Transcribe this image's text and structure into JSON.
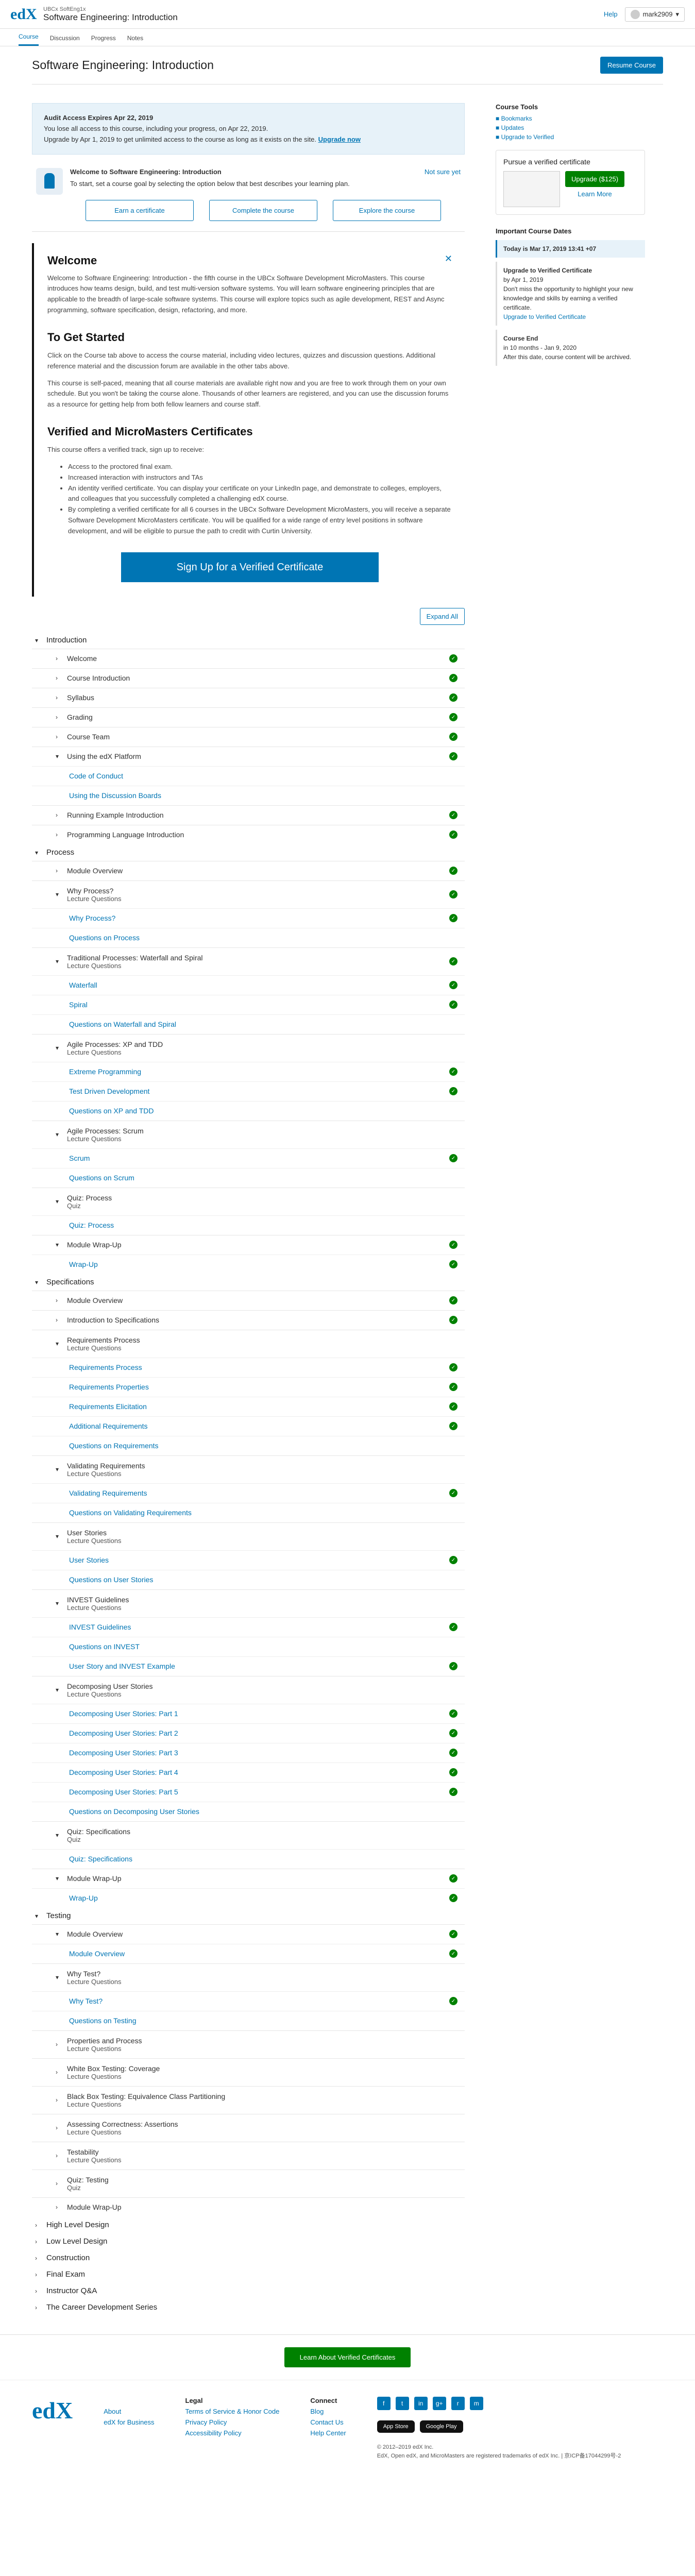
{
  "header": {
    "logo": "edX",
    "org": "UBCx SoftEng1x",
    "course_title": "Software Engineering: Introduction",
    "help": "Help",
    "user": "mark2909"
  },
  "tabs": [
    "Course",
    "Discussion",
    "Progress",
    "Notes"
  ],
  "page": {
    "title": "Software Engineering: Introduction",
    "resume": "Resume Course"
  },
  "alert": {
    "title": "Audit Access Expires Apr 22, 2019",
    "line1": "You lose all access to this course, including your progress, on Apr 22, 2019.",
    "line2": "Upgrade by Apr 1, 2019 to get unlimited access to the course as long as it exists on the site.",
    "link": "Upgrade now"
  },
  "goal": {
    "title": "Welcome to Software Engineering: Introduction",
    "not_sure": "Not sure yet",
    "text": "To start, set a course goal by selecting the option below that best describes your learning plan.",
    "buttons": [
      "Earn a certificate",
      "Complete the course",
      "Explore the course"
    ]
  },
  "welcome": {
    "h_welcome": "Welcome",
    "p1": "Welcome to Software Engineering: Introduction - the fifth course in the UBCx Software Development MicroMasters. This course introduces how teams design, build, and test multi-version software systems. You will learn software engineering principles that are applicable to the breadth of large-scale software systems. This course will explore topics such as agile development, REST and Async programming, software specification, design, refactoring, and more.",
    "h_started": "To Get Started",
    "p2": "Click on the Course tab above to access the course material, including video lectures, quizzes and discussion questions. Additional reference material and the discussion forum are available in the other tabs above.",
    "p3": "This course is self-paced, meaning that all course materials are available right now and you are free to work through them on your own schedule. But you won't be taking the course alone. Thousands of other learners are registered, and you can use the discussion forums as a resource for getting help from both fellow learners and course staff.",
    "h_verified": "Verified and MicroMasters Certificates",
    "p4": "This course offers a verified track, sign up to receive:",
    "bullets": [
      "Access to the proctored final exam.",
      "Increased interaction with instructors and TAs",
      "An identity verified certificate. You can display your certificate on your LinkedIn page, and demonstrate to colleges, employers, and colleagues that you successfully completed a challenging edX course.",
      "By completing a verified certificate for all 6 courses in the UBCx Software Development MicroMasters, you will receive a separate Software Development MicroMasters certificate. You will be qualified for a wide range of entry level positions in software development, and will be eligible to pursue the path to credit with Curtin University."
    ],
    "signup": "Sign Up for a Verified Certificate"
  },
  "expand_all": "Expand All",
  "outline": [
    {
      "title": "Introduction",
      "open": true,
      "subs": [
        {
          "title": "Welcome",
          "done": true
        },
        {
          "title": "Course Introduction",
          "done": true
        },
        {
          "title": "Syllabus",
          "done": true
        },
        {
          "title": "Grading",
          "done": true
        },
        {
          "title": "Course Team",
          "done": true
        },
        {
          "title": "Using the edX Platform",
          "done": true,
          "open": true,
          "units": [
            {
              "title": "Code of Conduct",
              "done": false
            },
            {
              "title": "Using the Discussion Boards",
              "done": false
            }
          ]
        },
        {
          "title": "Running Example Introduction",
          "done": true
        },
        {
          "title": "Programming Language Introduction",
          "done": true
        }
      ]
    },
    {
      "title": "Process",
      "open": true,
      "subs": [
        {
          "title": "Module Overview",
          "done": true
        },
        {
          "title": "Why Process?",
          "type": "Lecture Questions",
          "done": true,
          "open": true,
          "units": [
            {
              "title": "Why Process?",
              "done": true
            },
            {
              "title": "Questions on Process",
              "done": false
            }
          ]
        },
        {
          "title": "Traditional Processes: Waterfall and Spiral",
          "type": "Lecture Questions",
          "done": true,
          "open": true,
          "units": [
            {
              "title": "Waterfall",
              "done": true
            },
            {
              "title": "Spiral",
              "done": true
            },
            {
              "title": "Questions on Waterfall and Spiral",
              "done": false
            }
          ]
        },
        {
          "title": "Agile Processes: XP and TDD",
          "type": "Lecture Questions",
          "done": false,
          "open": true,
          "units": [
            {
              "title": "Extreme Programming",
              "done": true
            },
            {
              "title": "Test Driven Development",
              "done": true
            },
            {
              "title": "Questions on XP and TDD",
              "done": false
            }
          ]
        },
        {
          "title": "Agile Processes: Scrum",
          "type": "Lecture Questions",
          "done": false,
          "open": true,
          "units": [
            {
              "title": "Scrum",
              "done": true
            },
            {
              "title": "Questions on Scrum",
              "done": false
            }
          ]
        },
        {
          "title": "Quiz: Process",
          "type": "Quiz",
          "done": false,
          "open": true,
          "units": [
            {
              "title": "Quiz: Process",
              "done": false
            }
          ]
        },
        {
          "title": "Module Wrap-Up",
          "done": true,
          "open": true,
          "units": [
            {
              "title": "Wrap-Up",
              "done": true
            }
          ]
        }
      ]
    },
    {
      "title": "Specifications",
      "open": true,
      "subs": [
        {
          "title": "Module Overview",
          "done": true
        },
        {
          "title": "Introduction to Specifications",
          "done": true
        },
        {
          "title": "Requirements Process",
          "type": "Lecture Questions",
          "done": false,
          "open": true,
          "units": [
            {
              "title": "Requirements Process",
              "done": true
            },
            {
              "title": "Requirements Properties",
              "done": true
            },
            {
              "title": "Requirements Elicitation",
              "done": true
            },
            {
              "title": "Additional Requirements",
              "done": true
            },
            {
              "title": "Questions on Requirements",
              "done": false
            }
          ]
        },
        {
          "title": "Validating Requirements",
          "type": "Lecture Questions",
          "done": false,
          "open": true,
          "units": [
            {
              "title": "Validating Requirements",
              "done": true
            },
            {
              "title": "Questions on Validating Requirements",
              "done": false
            }
          ]
        },
        {
          "title": "User Stories",
          "type": "Lecture Questions",
          "done": false,
          "open": true,
          "units": [
            {
              "title": "User Stories",
              "done": true
            },
            {
              "title": "Questions on User Stories",
              "done": false
            }
          ]
        },
        {
          "title": "INVEST Guidelines",
          "type": "Lecture Questions",
          "done": false,
          "open": true,
          "units": [
            {
              "title": "INVEST Guidelines",
              "done": true
            },
            {
              "title": "Questions on INVEST",
              "done": false
            },
            {
              "title": "User Story and INVEST Example",
              "done": true
            }
          ]
        },
        {
          "title": "Decomposing User Stories",
          "type": "Lecture Questions",
          "done": false,
          "open": true,
          "units": [
            {
              "title": "Decomposing User Stories: Part 1",
              "done": true
            },
            {
              "title": "Decomposing User Stories: Part 2",
              "done": true
            },
            {
              "title": "Decomposing User Stories: Part 3",
              "done": true
            },
            {
              "title": "Decomposing User Stories: Part 4",
              "done": true
            },
            {
              "title": "Decomposing User Stories: Part 5",
              "done": true
            },
            {
              "title": "Questions on Decomposing User Stories",
              "done": false
            }
          ]
        },
        {
          "title": "Quiz: Specifications",
          "type": "Quiz",
          "done": false,
          "open": true,
          "units": [
            {
              "title": "Quiz: Specifications",
              "done": false
            }
          ]
        },
        {
          "title": "Module Wrap-Up",
          "done": true,
          "open": true,
          "units": [
            {
              "title": "Wrap-Up",
              "done": true
            }
          ]
        }
      ]
    },
    {
      "title": "Testing",
      "open": true,
      "subs": [
        {
          "title": "Module Overview",
          "done": true,
          "open": true,
          "units": [
            {
              "title": "Module Overview",
              "done": true
            }
          ]
        },
        {
          "title": "Why Test?",
          "type": "Lecture Questions",
          "done": false,
          "open": true,
          "units": [
            {
              "title": "Why Test?",
              "done": true
            },
            {
              "title": "Questions on Testing",
              "done": false
            }
          ]
        },
        {
          "title": "Properties and Process",
          "type": "Lecture Questions",
          "done": false
        },
        {
          "title": "White Box Testing: Coverage",
          "type": "Lecture Questions",
          "done": false
        },
        {
          "title": "Black Box Testing: Equivalence Class Partitioning",
          "type": "Lecture Questions",
          "done": false
        },
        {
          "title": "Assessing Correctness: Assertions",
          "type": "Lecture Questions",
          "done": false
        },
        {
          "title": "Testability",
          "type": "Lecture Questions",
          "done": false
        },
        {
          "title": "Quiz: Testing",
          "type": "Quiz",
          "done": false
        },
        {
          "title": "Module Wrap-Up",
          "done": false
        }
      ]
    },
    {
      "title": "High Level Design",
      "open": false,
      "subs": []
    },
    {
      "title": "Low Level Design",
      "open": false,
      "subs": []
    },
    {
      "title": "Construction",
      "open": false,
      "subs": []
    },
    {
      "title": "Final Exam",
      "open": false,
      "subs": []
    },
    {
      "title": "Instructor Q&A",
      "open": false,
      "subs": []
    },
    {
      "title": "The Career Development Series",
      "open": false,
      "subs": []
    }
  ],
  "sidebar": {
    "tools_title": "Course Tools",
    "tools": [
      "Bookmarks",
      "Updates",
      "Upgrade to Verified"
    ],
    "verify_title": "Pursue a verified certificate",
    "upgrade_btn": "Upgrade ($125)",
    "learn_more": "Learn More",
    "dates_title": "Important Course Dates",
    "today": "Today is Mar 17, 2019 13:41 +07",
    "dates": [
      {
        "title": "Upgrade to Verified Certificate",
        "date": "by Apr 1, 2019",
        "text": "Don't miss the opportunity to highlight your new knowledge and skills by earning a verified certificate.",
        "link": "Upgrade to Verified Certificate"
      },
      {
        "title": "Course End",
        "date": "in 10 months - Jan 9, 2020",
        "text": "After this date, course content will be archived.",
        "link": ""
      }
    ]
  },
  "footer": {
    "cta": "Learn About Verified Certificates",
    "logo": "edX",
    "col1": [
      "About",
      "edX for Business"
    ],
    "legal_title": "Legal",
    "legal": [
      "Terms of Service & Honor Code",
      "Privacy Policy",
      "Accessibility Policy"
    ],
    "connect_title": "Connect",
    "connect": [
      "Blog",
      "Contact Us",
      "Help Center"
    ],
    "social": [
      "f",
      "t",
      "in",
      "g+",
      "r",
      "m"
    ],
    "stores": [
      "App Store",
      "Google Play"
    ],
    "copyright": "© 2012–2019 edX Inc.",
    "trademark": "EdX, Open edX, and MicroMasters are registered trademarks of edX Inc. | 京ICP备17044299号-2"
  }
}
